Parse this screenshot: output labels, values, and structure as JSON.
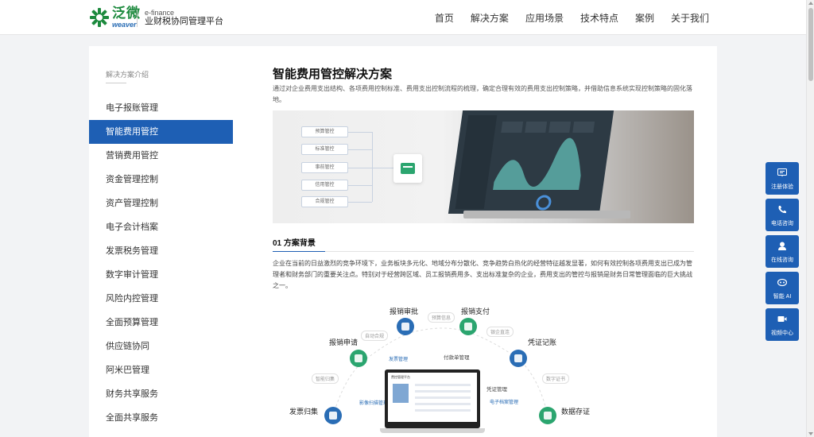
{
  "brand": {
    "logo_cn": "泛微",
    "logo_en": "weaver",
    "sub_en": "e-finance",
    "sub_cn": "业财税协同管理平台"
  },
  "nav": [
    "首页",
    "解决方案",
    "应用场景",
    "技术特点",
    "案例",
    "关于我们"
  ],
  "sidebar": {
    "heading": "解决方案介绍",
    "items": [
      {
        "label": "电子报账管理",
        "active": false
      },
      {
        "label": "智能费用管控",
        "active": true
      },
      {
        "label": "营销费用管控",
        "active": false
      },
      {
        "label": "资金管理控制",
        "active": false
      },
      {
        "label": "资产管理控制",
        "active": false
      },
      {
        "label": "电子会计档案",
        "active": false
      },
      {
        "label": "发票税务管理",
        "active": false
      },
      {
        "label": "数字审计管理",
        "active": false
      },
      {
        "label": "风险内控管理",
        "active": false
      },
      {
        "label": "全面预算管理",
        "active": false
      },
      {
        "label": "供应链协同",
        "active": false
      },
      {
        "label": "阿米巴管理",
        "active": false
      },
      {
        "label": "财务共享服务",
        "active": false
      },
      {
        "label": "全面共享服务",
        "active": false
      }
    ]
  },
  "main": {
    "title": "智能费用管控解决方案",
    "description": "通过对企业费用支出结构、各项费用控制标准、费用支出控制流程的梳理，确定合理有效的费用支出控制策略，并借助信息系统实现控制策略的固化落地。",
    "hero_tags": [
      "预算管控",
      "标准管控",
      "事前管控",
      "信用管控",
      "合规管控"
    ],
    "section1": {
      "title": "01  方案背景",
      "body": "企业在当前的日益激烈的竞争环境下，业务板块多元化、地域分布分散化、竞争趋势白热化的经营特征越发显著，如何有效控制各项费用支出已成为管理者和财务部门的重要关注点。特别对于经营跨区域、员工报销费用多、支出标准复杂的企业，费用支出的管控与报销是财务日常管理面临的巨大挑战之一。"
    },
    "flow": {
      "nodes": [
        "报销审批",
        "报销支付",
        "报销申请",
        "凭证记账",
        "发票归集",
        "数据存证"
      ],
      "pills": [
        "预算信息",
        "自动合规",
        "银企直连",
        "智能归集",
        "数字证书"
      ],
      "blue_notes": [
        "发票管理",
        "影像扫描管理",
        "凭证管理",
        "电子档案管理"
      ],
      "dark_notes": [
        "付款单管理",
        "凭证管理"
      ],
      "monitor_title": "费控管理平台"
    }
  },
  "float_buttons": [
    {
      "label": "注册体验",
      "icon": "register-icon"
    },
    {
      "label": "电话咨询",
      "icon": "phone-icon"
    },
    {
      "label": "在线咨询",
      "icon": "chat-icon"
    },
    {
      "label": "智能 AI",
      "icon": "ai-icon"
    },
    {
      "label": "视频中心",
      "icon": "video-icon"
    }
  ],
  "colors": {
    "accent": "#1e5fb4",
    "green": "#2ba56f"
  }
}
